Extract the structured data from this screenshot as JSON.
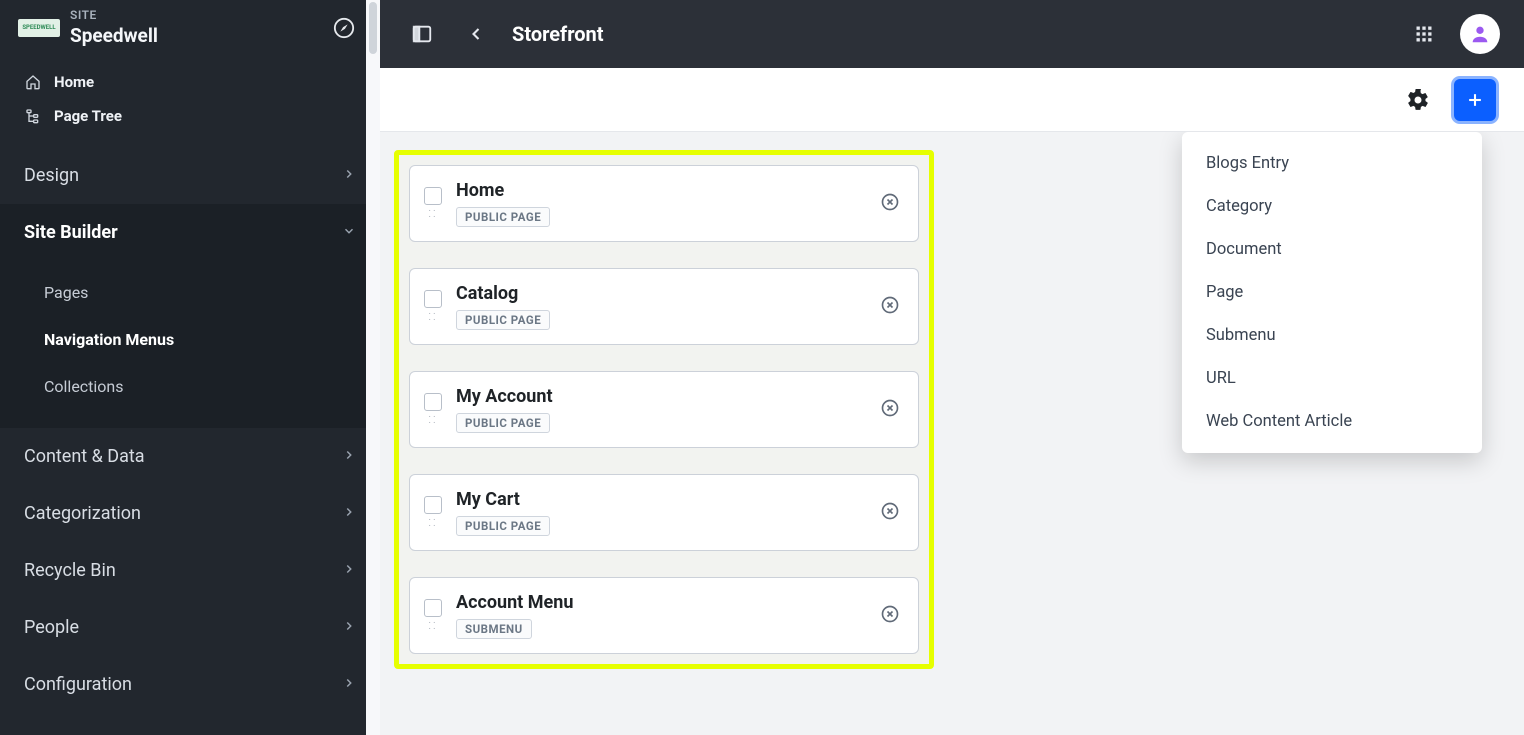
{
  "site": {
    "label": "SITE",
    "name": "Speedwell",
    "logo_text": "SPEEDWELL"
  },
  "sidebar": {
    "quick": [
      {
        "label": "Home",
        "icon": "home-icon"
      },
      {
        "label": "Page Tree",
        "icon": "tree-icon"
      }
    ],
    "sections": [
      {
        "label": "Design",
        "expanded": false
      },
      {
        "label": "Site Builder",
        "expanded": true,
        "children": [
          {
            "label": "Pages",
            "active": false
          },
          {
            "label": "Navigation Menus",
            "active": true
          },
          {
            "label": "Collections",
            "active": false
          }
        ]
      },
      {
        "label": "Content & Data",
        "expanded": false
      },
      {
        "label": "Categorization",
        "expanded": false
      },
      {
        "label": "Recycle Bin",
        "expanded": false
      },
      {
        "label": "People",
        "expanded": false
      },
      {
        "label": "Configuration",
        "expanded": false
      }
    ]
  },
  "header": {
    "title": "Storefront"
  },
  "menu_items": [
    {
      "title": "Home",
      "type": "PUBLIC PAGE"
    },
    {
      "title": "Catalog",
      "type": "PUBLIC PAGE"
    },
    {
      "title": "My Account",
      "type": "PUBLIC PAGE"
    },
    {
      "title": "My Cart",
      "type": "PUBLIC PAGE"
    },
    {
      "title": "Account Menu",
      "type": "SUBMENU"
    }
  ],
  "add_dropdown": {
    "options": [
      "Blogs Entry",
      "Category",
      "Document",
      "Page",
      "Submenu",
      "URL",
      "Web Content Article"
    ]
  }
}
